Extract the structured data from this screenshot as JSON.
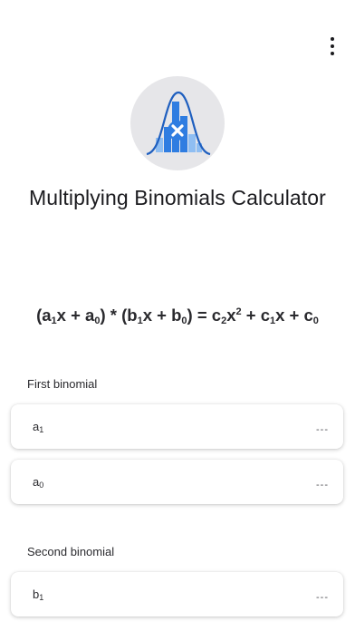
{
  "header": {
    "menu_icon": "more-vert-icon"
  },
  "app": {
    "title": "Multiplying Binomials Calculator",
    "logo_icon": "bell-curve-multiply-icon",
    "colors": {
      "logo_bg": "#e6e6e9",
      "accent": "#2f7de1",
      "accent_light": "#8fbef2",
      "curve": "#1f5fbf"
    }
  },
  "formula": {
    "open_paren": "(",
    "a1_base": "a",
    "a1_sub": "1",
    "x_plus": "x + ",
    "a0_base": "a",
    "a0_sub": "0",
    "times": ") * (",
    "b1_base": "b",
    "b1_sub": "1",
    "x_plus_2": "x + ",
    "b0_base": "b",
    "b0_sub": "0",
    "equals": ") = ",
    "c2_base": "c",
    "c2_sub": "2",
    "x2": "x",
    "x2_sup": "2",
    "plus1": " + ",
    "c1_base": "c",
    "c1_sub": "1",
    "x_plus_3": "x + ",
    "c0_base": "c",
    "c0_sub": "0"
  },
  "first_binomial": {
    "label": "First binomial",
    "fields": [
      {
        "base": "a",
        "sub": "1",
        "value": "---"
      },
      {
        "base": "a",
        "sub": "0",
        "value": "---"
      }
    ]
  },
  "second_binomial": {
    "label": "Second binomial",
    "fields": [
      {
        "base": "b",
        "sub": "1",
        "value": "---"
      }
    ]
  }
}
